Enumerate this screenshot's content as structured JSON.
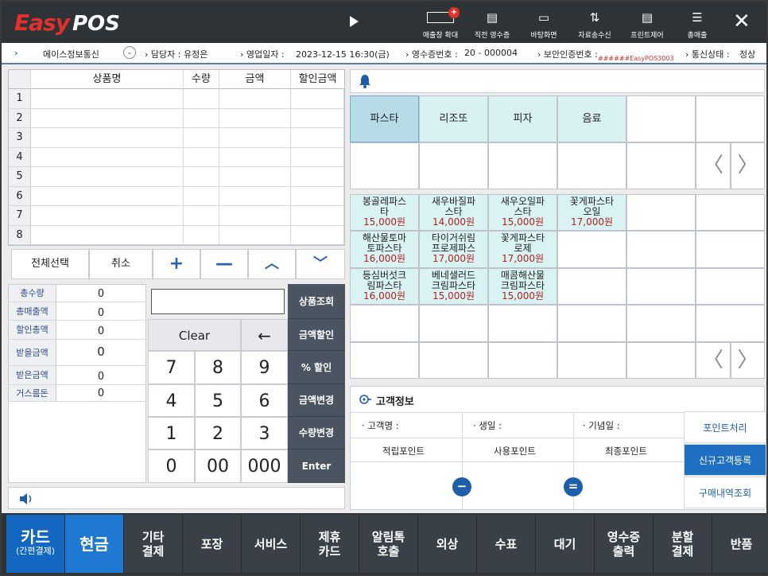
{
  "header": {
    "logo_easy": "Easy",
    "logo_pos": "POS",
    "badge": "+",
    "buttons": [
      {
        "label": "매출창 확대",
        "icon": "screen-icon"
      },
      {
        "label": "직전 영수증",
        "icon": "receipt-icon"
      },
      {
        "label": "바탕화면",
        "icon": "desktop-icon"
      },
      {
        "label": "자료송수신",
        "icon": "transfer-icon"
      },
      {
        "label": "프린트제어",
        "icon": "printer-icon"
      },
      {
        "label": "총매출",
        "icon": "list-icon"
      }
    ],
    "close": "✕"
  },
  "status": {
    "store": "에이스정보통신",
    "manager": "› 담당자 : 유정은",
    "business_date": "› 영업일자 :",
    "datetime": "2023-12-15 16:30(금)",
    "receipt_no": "› 영수증번호 :",
    "receipt_val": "20 -    000004",
    "security": "› 보안인증번호 :",
    "security_code": "######EasyPOS3003",
    "comm": "› 통신상태 :",
    "comm_val": "정상"
  },
  "table": {
    "headers": [
      "상품명",
      "수량",
      "금액",
      "할인금액"
    ],
    "rows": [
      "1",
      "2",
      "3",
      "4",
      "5",
      "6",
      "7",
      "8"
    ]
  },
  "controls": {
    "select_all": "전체선택",
    "cancel": "취소",
    "plus": "+",
    "minus": "—",
    "up": "︿",
    "down": "﹀"
  },
  "totals": [
    {
      "label": "총수량",
      "value": "0"
    },
    {
      "label": "총매출액",
      "value": "0"
    },
    {
      "label": "할인총액",
      "value": "0"
    },
    {
      "label": "받을금액",
      "value": "0"
    },
    {
      "label": "받은금액",
      "value": "0"
    },
    {
      "label": "거스름돈",
      "value": "0"
    }
  ],
  "keypad": {
    "clear": "Clear",
    "backspace": "←",
    "keys": [
      "7",
      "8",
      "9",
      "4",
      "5",
      "6",
      "1",
      "2",
      "3",
      "0",
      "00",
      "000"
    ],
    "side": [
      "상품조회",
      "금액할인",
      "% 할인",
      "금액변경",
      "수량변경",
      "Enter"
    ]
  },
  "categories": [
    "파스타",
    "리조또",
    "피자",
    "음료"
  ],
  "products": [
    {
      "name1": "봉골레파스",
      "name2": "타",
      "price": "15,000원"
    },
    {
      "name1": "새우바질파",
      "name2": "스타",
      "price": "14,000원"
    },
    {
      "name1": "새우오일파",
      "name2": "스타",
      "price": "15,000원"
    },
    {
      "name1": "꽃게파스타",
      "name2": "오일",
      "price": "17,000원"
    },
    {
      "name1": "해산물토마",
      "name2": "토파스타",
      "price": "16,000원"
    },
    {
      "name1": "타이거쉬림",
      "name2": "프로제파스",
      "price": "17,000원"
    },
    {
      "name1": "꽃게파스타",
      "name2": "로제",
      "price": "17,000원"
    },
    {
      "name1": "등심버섯크",
      "name2": "림파스타",
      "price": "16,000원"
    },
    {
      "name1": "베네샐러드",
      "name2": "크림파스타",
      "price": "15,000원"
    },
    {
      "name1": "매콤해산물",
      "name2": "크림파스타",
      "price": "15,000원"
    }
  ],
  "arrows": {
    "prev": "〈",
    "next": "〉"
  },
  "customer": {
    "title": "고객정보",
    "name": "· 고객명 :",
    "birthday": "· 생일 :",
    "anniversary": "· 기념일 :",
    "earn_points": "적립포인트",
    "use_points": "사용포인트",
    "final_points": "최종포인트",
    "minus": "−",
    "equals": "=",
    "side_buttons": [
      "포인트처리",
      "신규고객등록",
      "구매내역조회"
    ]
  },
  "bottom": [
    {
      "line1": "카드",
      "line2": "(간편결제)"
    },
    {
      "line1": "현금",
      "line2": ""
    },
    {
      "line1": "기타",
      "line2": "결제"
    },
    {
      "line1": "포장",
      "line2": ""
    },
    {
      "line1": "서비스",
      "line2": ""
    },
    {
      "line1": "제휴",
      "line2": "카드"
    },
    {
      "line1": "알림톡",
      "line2": "호출"
    },
    {
      "line1": "외상",
      "line2": ""
    },
    {
      "line1": "수표",
      "line2": ""
    },
    {
      "line1": "대기",
      "line2": ""
    },
    {
      "line1": "영수증",
      "line2": "출력"
    },
    {
      "line1": "분할",
      "line2": "결제"
    },
    {
      "line1": "반품",
      "line2": ""
    }
  ]
}
